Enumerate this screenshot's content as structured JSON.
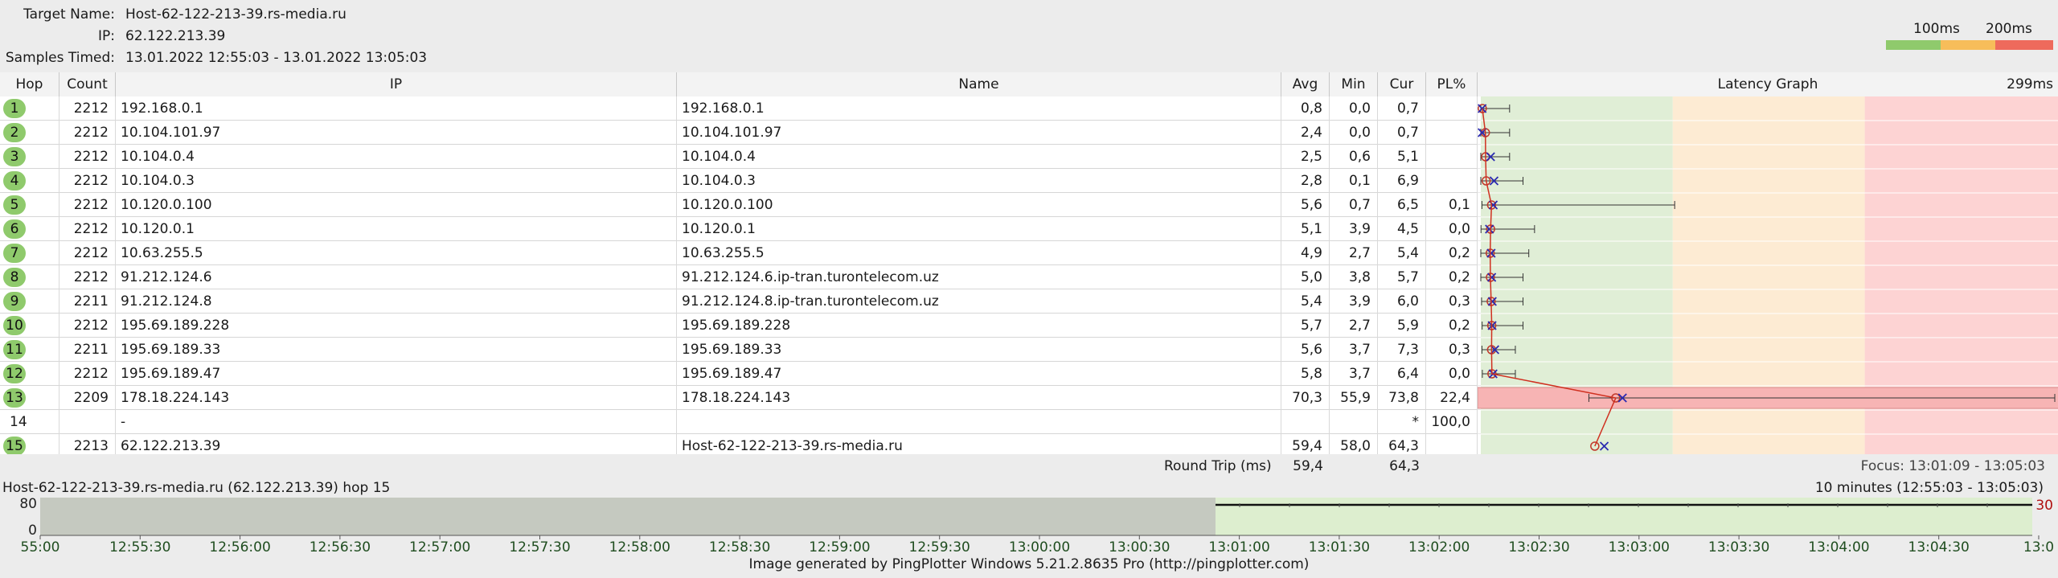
{
  "header": {
    "target_label": "Target Name:",
    "target_value": "Host-62-122-213-39.rs-media.ru",
    "ip_label": "IP:",
    "ip_value": "62.122.213.39",
    "samples_label": "Samples Timed:",
    "samples_value": "13.01.2022 12:55:03 - 13.01.2022 13:05:03",
    "legend_100": "100ms",
    "legend_200": "200ms",
    "legend_colors": [
      "#8fca6c",
      "#f7bd5a",
      "#ee6a5c"
    ]
  },
  "columns": {
    "hop": "Hop",
    "count": "Count",
    "ip": "IP",
    "name": "Name",
    "avg": "Avg",
    "min": "Min",
    "cur": "Cur",
    "pl": "PL%",
    "graph": "Latency Graph",
    "graph_max": "299ms"
  },
  "hops": [
    {
      "hop": "1",
      "count": "2212",
      "ip": "192.168.0.1",
      "name": "192.168.0.1",
      "avg": "0,8",
      "min": "0,0",
      "cur": "0,7",
      "pl": ""
    },
    {
      "hop": "2",
      "count": "2212",
      "ip": "10.104.101.97",
      "name": "10.104.101.97",
      "avg": "2,4",
      "min": "0,0",
      "cur": "0,7",
      "pl": ""
    },
    {
      "hop": "3",
      "count": "2212",
      "ip": "10.104.0.4",
      "name": "10.104.0.4",
      "avg": "2,5",
      "min": "0,6",
      "cur": "5,1",
      "pl": ""
    },
    {
      "hop": "4",
      "count": "2212",
      "ip": "10.104.0.3",
      "name": "10.104.0.3",
      "avg": "2,8",
      "min": "0,1",
      "cur": "6,9",
      "pl": ""
    },
    {
      "hop": "5",
      "count": "2212",
      "ip": "10.120.0.100",
      "name": "10.120.0.100",
      "avg": "5,6",
      "min": "0,7",
      "cur": "6,5",
      "pl": "0,1"
    },
    {
      "hop": "6",
      "count": "2212",
      "ip": "10.120.0.1",
      "name": "10.120.0.1",
      "avg": "5,1",
      "min": "3,9",
      "cur": "4,5",
      "pl": "0,0"
    },
    {
      "hop": "7",
      "count": "2212",
      "ip": "10.63.255.5",
      "name": "10.63.255.5",
      "avg": "4,9",
      "min": "2,7",
      "cur": "5,4",
      "pl": "0,2"
    },
    {
      "hop": "8",
      "count": "2212",
      "ip": "91.212.124.6",
      "name": "91.212.124.6.ip-tran.turontelecom.uz",
      "avg": "5,0",
      "min": "3,8",
      "cur": "5,7",
      "pl": "0,2"
    },
    {
      "hop": "9",
      "count": "2211",
      "ip": "91.212.124.8",
      "name": "91.212.124.8.ip-tran.turontelecom.uz",
      "avg": "5,4",
      "min": "3,9",
      "cur": "6,0",
      "pl": "0,3"
    },
    {
      "hop": "10",
      "count": "2212",
      "ip": "195.69.189.228",
      "name": "195.69.189.228",
      "avg": "5,7",
      "min": "2,7",
      "cur": "5,9",
      "pl": "0,2"
    },
    {
      "hop": "11",
      "count": "2211",
      "ip": "195.69.189.33",
      "name": "195.69.189.33",
      "avg": "5,6",
      "min": "3,7",
      "cur": "7,3",
      "pl": "0,3"
    },
    {
      "hop": "12",
      "count": "2212",
      "ip": "195.69.189.47",
      "name": "195.69.189.47",
      "avg": "5,8",
      "min": "3,7",
      "cur": "6,4",
      "pl": "0,0"
    },
    {
      "hop": "13",
      "count": "2209",
      "ip": "178.18.224.143",
      "name": "178.18.224.143",
      "avg": "70,3",
      "min": "55,9",
      "cur": "73,8",
      "pl": "22,4"
    },
    {
      "hop": "14",
      "count": "",
      "ip": "-",
      "name": "",
      "avg": "",
      "min": "",
      "cur": "*",
      "pl": "100,0"
    },
    {
      "hop": "15",
      "count": "2213",
      "ip": "62.122.213.39",
      "name": "Host-62-122-213-39.rs-media.ru",
      "avg": "59,4",
      "min": "58,0",
      "cur": "64,3",
      "pl": ""
    }
  ],
  "latency_graph": {
    "scale_max_ms": 299,
    "zone_colors": [
      "#e0eed6",
      "#fdebd3",
      "#fdd3d3"
    ],
    "hops": [
      {
        "avg": 0.8,
        "cur": 0.7,
        "max": 15
      },
      {
        "avg": 2.4,
        "cur": 0.7,
        "max": 15
      },
      {
        "avg": 2.5,
        "cur": 5.1,
        "max": 15
      },
      {
        "avg": 2.8,
        "cur": 6.9,
        "max": 22
      },
      {
        "avg": 5.6,
        "cur": 6.5,
        "max": 101
      },
      {
        "avg": 5.1,
        "cur": 4.5,
        "max": 28
      },
      {
        "avg": 4.9,
        "cur": 5.4,
        "max": 25
      },
      {
        "avg": 5.0,
        "cur": 5.7,
        "max": 22
      },
      {
        "avg": 5.4,
        "cur": 6.0,
        "max": 22
      },
      {
        "avg": 5.7,
        "cur": 5.9,
        "max": 22
      },
      {
        "avg": 5.6,
        "cur": 7.3,
        "max": 18
      },
      {
        "avg": 5.8,
        "cur": 6.4,
        "max": 18
      },
      {
        "avg": 70.3,
        "cur": 73.8,
        "max": 299,
        "pl": 22.4
      },
      null,
      {
        "avg": 59.4,
        "cur": 64.3,
        "max": null
      }
    ]
  },
  "summary": {
    "label": "Round Trip (ms)",
    "avg": "59,4",
    "cur": "64,3",
    "focus": "Focus: 13:01:09 - 13:05:03"
  },
  "timeline": {
    "title": "Host-62-122-213-39.rs-media.ru (62.122.213.39) hop 15",
    "range": "10 minutes (12:55:03 - 13:05:03)",
    "y_top": "80",
    "y_bottom": "0",
    "right_label": "30",
    "ticks": [
      "55:00",
      "12:55:30",
      "12:56:00",
      "12:56:30",
      "12:57:00",
      "12:57:30",
      "12:58:00",
      "12:58:30",
      "12:59:00",
      "12:59:30",
      "13:00:00",
      "13:00:30",
      "13:01:00",
      "13:01:30",
      "13:02:00",
      "13:02:30",
      "13:03:00",
      "13:03:30",
      "13:04:00",
      "13:04:30",
      "13:0"
    ],
    "focus_start_fraction": 0.59
  },
  "footer": "Image generated by PingPlotter Windows 5.21.2.8635 Pro (http://pingplotter.com)"
}
